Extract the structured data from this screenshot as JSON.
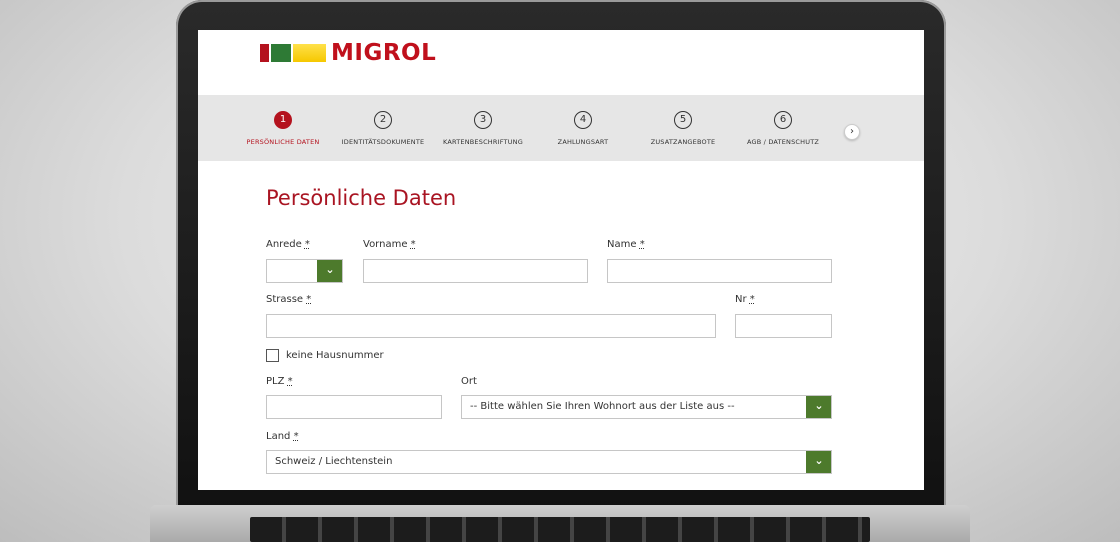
{
  "brand": {
    "name": "MIGROL"
  },
  "steps": [
    {
      "num": "1",
      "label": "PERSÖNLICHE DATEN"
    },
    {
      "num": "2",
      "label": "IDENTITÄTSDOKUMENTE"
    },
    {
      "num": "3",
      "label": "KARTENBESCHRIFTUNG"
    },
    {
      "num": "4",
      "label": "ZAHLUNGSART"
    },
    {
      "num": "5",
      "label": "ZUSATZANGEBOTE"
    },
    {
      "num": "6",
      "label": "AGB / DATENSCHUTZ"
    }
  ],
  "steps_next_icon": "chevron-right-icon",
  "form": {
    "title": "Persönliche Daten",
    "required_mark": "*",
    "anrede_label": "Anrede",
    "vorname_label": "Vorname",
    "name_label": "Name",
    "strasse_label": "Strasse",
    "nr_label": "Nr",
    "keine_hausnummer_label": "keine Hausnummer",
    "plz_label": "PLZ",
    "ort_label": "Ort",
    "ort_value": "-- Bitte wählen Sie Ihren Wohnort aus der Liste aus --",
    "land_label": "Land",
    "land_value": "Schweiz / Liechtenstein"
  },
  "colors": {
    "brand_red": "#b4121e",
    "accent_green": "#4d7a2c",
    "step_bar_bg": "#e6e6e6"
  }
}
